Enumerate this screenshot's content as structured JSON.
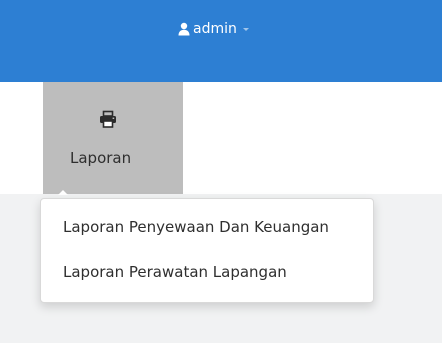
{
  "header": {
    "user": {
      "name": "admin",
      "icon": "user-icon"
    },
    "colors": {
      "topbar": "#2d7fd3"
    }
  },
  "nav": {
    "items": [
      {
        "label": "Laporan",
        "icon": "printer-icon",
        "active": true
      }
    ]
  },
  "dropdown": {
    "items": [
      {
        "label": "Laporan Penyewaan Dan Keuangan"
      },
      {
        "label": "Laporan Perawatan Lapangan"
      }
    ]
  }
}
